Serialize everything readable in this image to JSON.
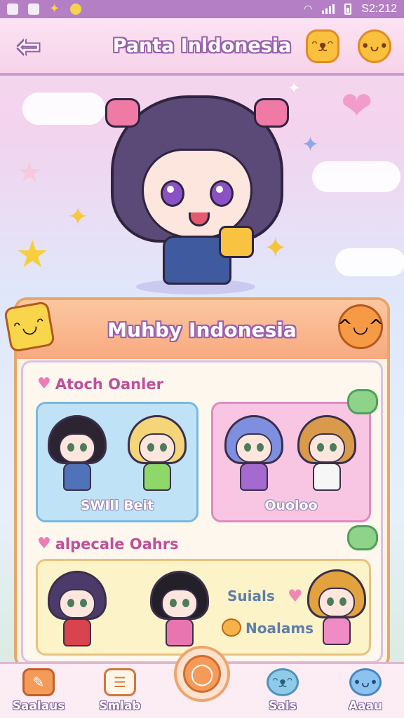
{
  "status_bar": {
    "time": "S2:212",
    "icons": [
      "person-icon",
      "image-icon",
      "star-icon",
      "notification-icon",
      "wifi-icon",
      "signal-icon",
      "sim-icon",
      "battery-icon"
    ]
  },
  "header": {
    "title": "Panta Inldonesia",
    "back_icon": "back-arrow-icon",
    "right_icons": [
      "mascot-face-icon",
      "mascot-pig-icon"
    ]
  },
  "hero": {
    "mascot": "chibi-girl-mascot"
  },
  "panel": {
    "title": "Muhby Indonesia",
    "section1_title": "Atoch Oanler",
    "category_cards": [
      {
        "label": "SWIll Beit"
      },
      {
        "label": "Ouoloo"
      }
    ],
    "section2_title": "alpecale Oahrs",
    "featured": {
      "label1": "Suials",
      "label2": "Noalams"
    }
  },
  "bottom_nav": {
    "items": [
      {
        "label": "Saalaus",
        "icon": "pencil-icon"
      },
      {
        "label": "Smlab",
        "icon": "notepad-icon"
      },
      {
        "label": "",
        "icon": "search-icon"
      },
      {
        "label": "Sals",
        "icon": "cat-icon"
      },
      {
        "label": "Aaau",
        "icon": "slime-icon"
      }
    ]
  },
  "colors": {
    "accent_purple": "#9b5fae",
    "accent_orange": "#f59b5a",
    "pink": "#ee7cb8",
    "header_bg": "#f7d3ea"
  }
}
